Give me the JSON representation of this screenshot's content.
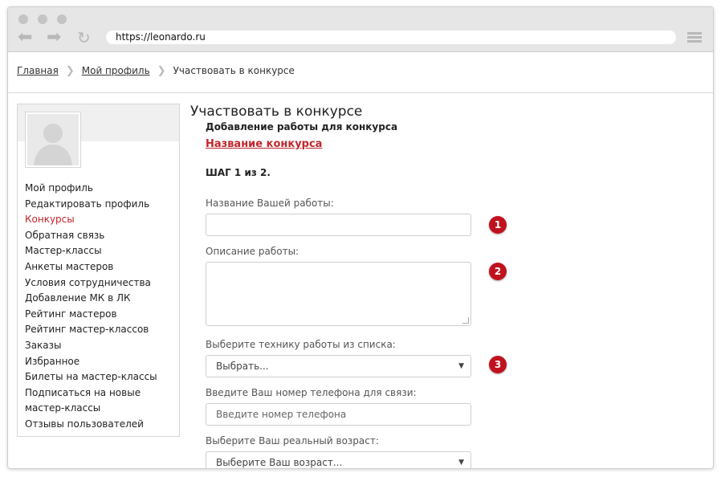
{
  "browser": {
    "url": "https://leonardo.ru"
  },
  "breadcrumb": {
    "items": [
      "Главная",
      "Мой профиль"
    ],
    "current": "Участвовать в конкурсе"
  },
  "sidebar": {
    "menu": [
      "Мой профиль",
      "Редактировать профиль",
      "Конкурсы",
      "Обратная связь",
      "Мастер-классы",
      "Анкеты мастеров",
      "Условия сотрудничества",
      "Добавление МК в ЛК",
      "Рейтинг мастеров",
      "Рейтинг мастер-классов",
      "Заказы",
      "Избранное",
      "Билеты на мастер-классы",
      "Подписаться на новые мастер-классы",
      "Отзывы пользователей"
    ],
    "active_index": 2
  },
  "content": {
    "title": "Участвовать в конкурсе",
    "subtitle": "Добавление работы для конкурса",
    "contest_link": "Название конкурса",
    "step": "ШАГ 1 из 2.",
    "fields": {
      "work_name_label": "Название Вашей работы:",
      "work_name_value": "",
      "description_label": "Описание работы:",
      "description_value": "",
      "technique_label": "Выберите технику работы из списка:",
      "technique_selected": "Выбрать...",
      "phone_label": "Введите Ваш номер телефона для связи:",
      "phone_placeholder": "Введите номер телефона",
      "age_label": "Выберите Ваш реальный возраст:",
      "age_selected": "Выберите Ваш возраст..."
    },
    "badges": [
      "1",
      "2",
      "3"
    ]
  },
  "colors": {
    "accent": "#c0262b",
    "badge": "#c0121e"
  }
}
